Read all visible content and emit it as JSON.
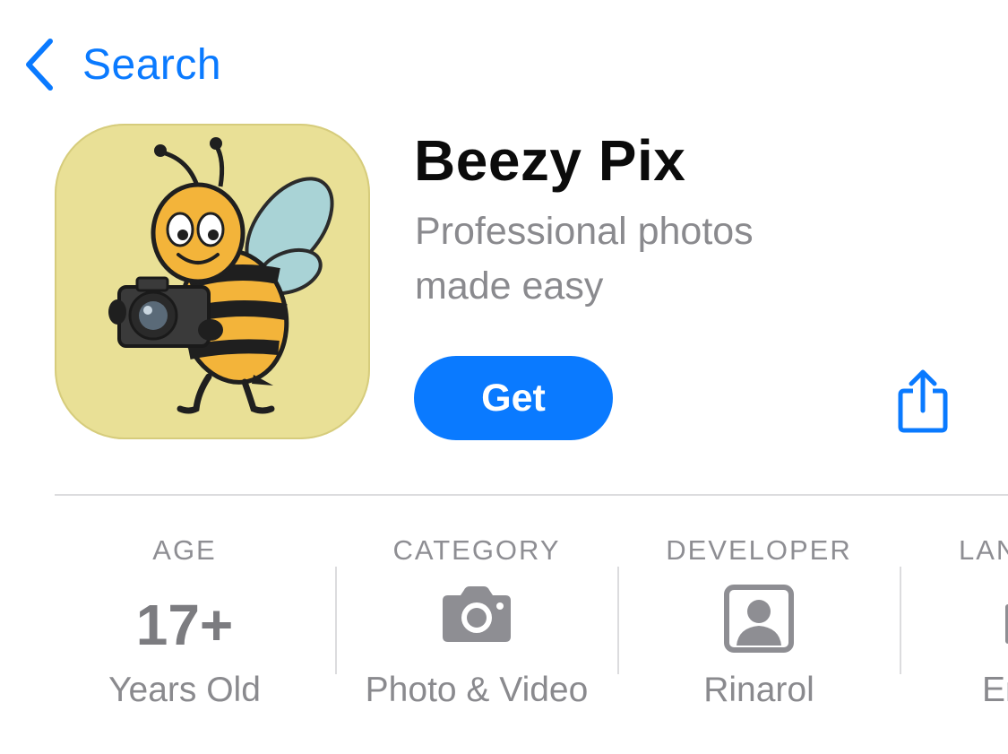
{
  "nav": {
    "back_label": "Search"
  },
  "app": {
    "name": "Beezy Pix",
    "subtitle": "Professional photos made easy",
    "get_label": "Get"
  },
  "info": [
    {
      "header": "AGE",
      "value": "17+",
      "sub": "Years Old"
    },
    {
      "header": "CATEGORY",
      "icon": "camera-icon",
      "sub": "Photo & Video"
    },
    {
      "header": "DEVELOPER",
      "icon": "developer-avatar-icon",
      "sub": "Rinarol"
    },
    {
      "header": "LAN",
      "icon": "language-icon",
      "sub": "En"
    }
  ],
  "colors": {
    "accent": "#0a7aff",
    "secondary_text": "#8a8a8e",
    "icon_bg": "#e9e096"
  }
}
